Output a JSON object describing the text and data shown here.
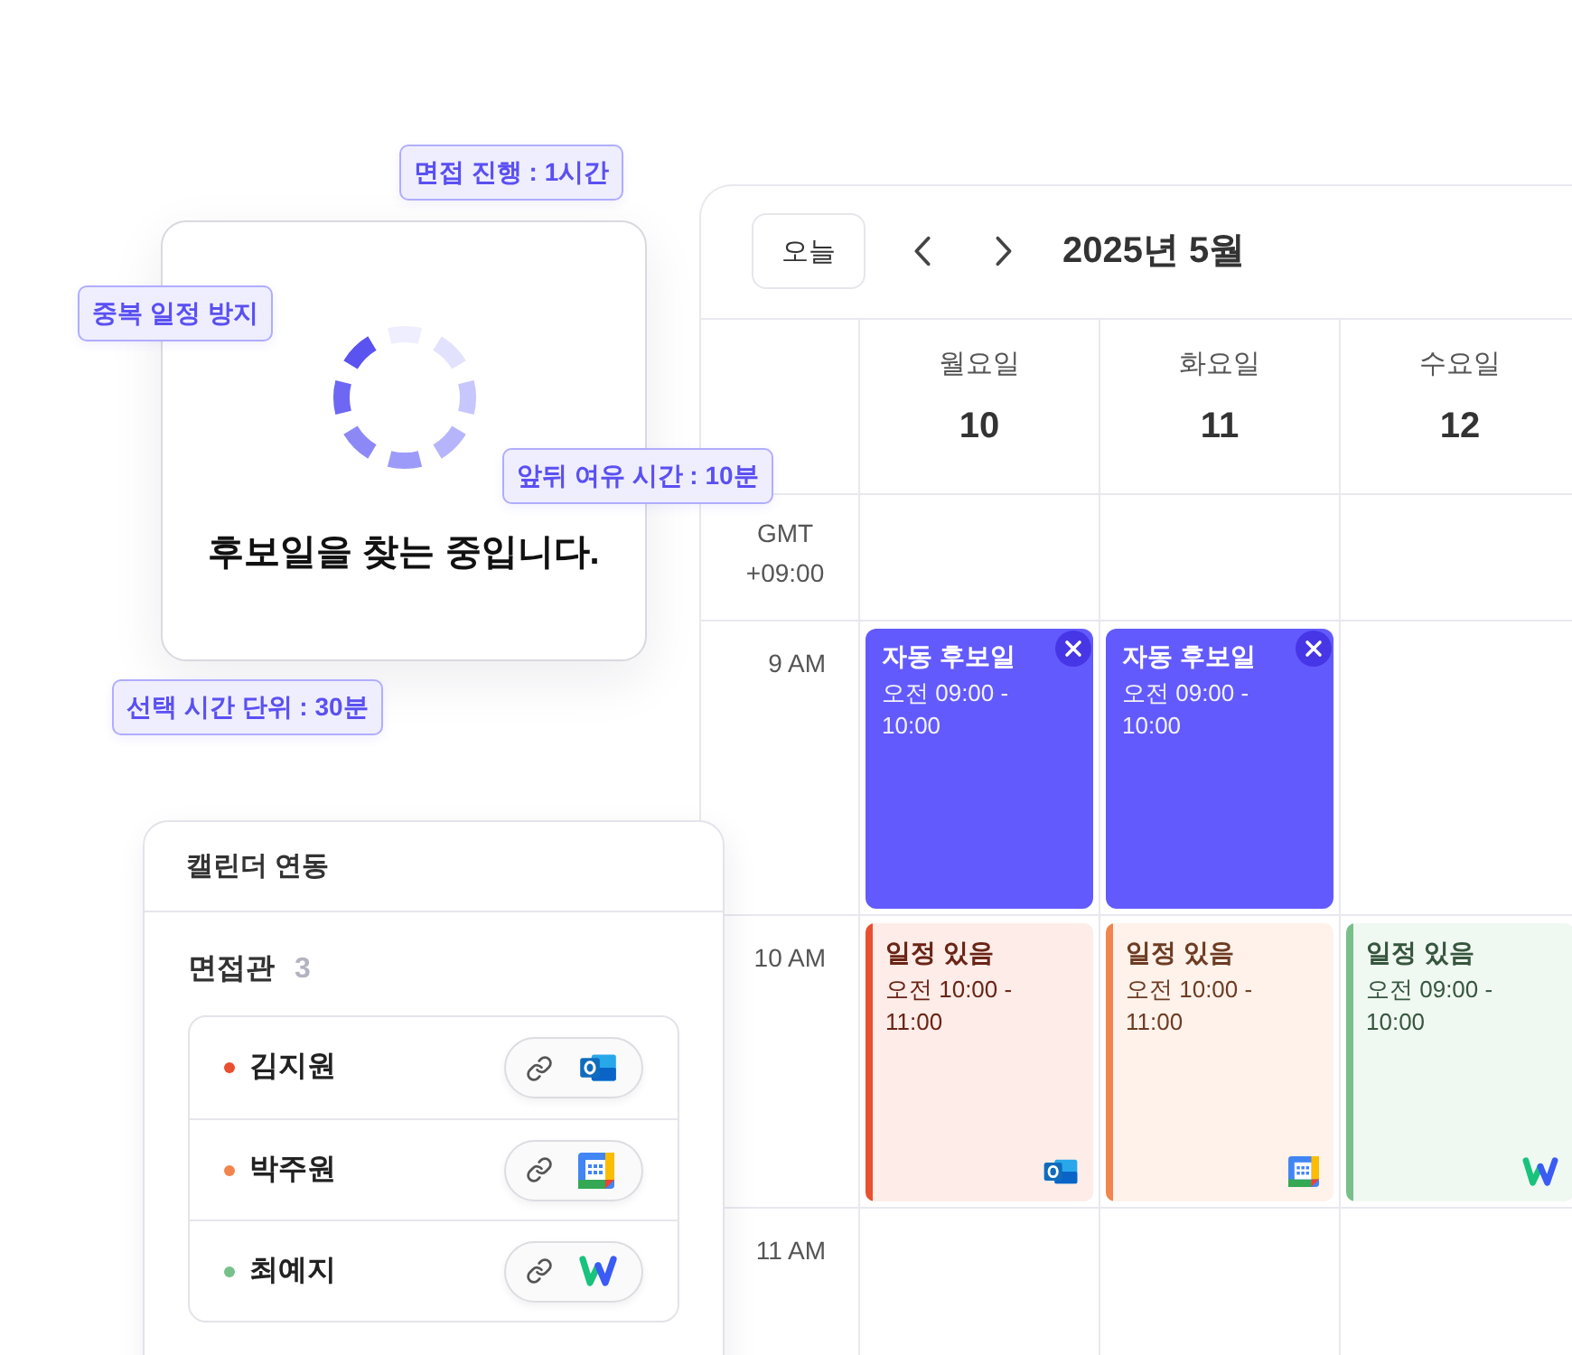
{
  "badges": [
    {
      "text": "면접 진행 : 1시간"
    },
    {
      "text": "중복 일정 방지"
    },
    {
      "text": "앞뒤 여유 시간 : 10분"
    },
    {
      "text": "선택 시간 단위 : 30분"
    }
  ],
  "loading_card": {
    "message": "후보일을 찾는 중입니다."
  },
  "calendar": {
    "today_button": "오늘",
    "title": "2025년 5월",
    "days": [
      {
        "weekday": "월요일",
        "date": "10"
      },
      {
        "weekday": "화요일",
        "date": "11"
      },
      {
        "weekday": "수요일",
        "date": "12"
      }
    ],
    "timezone": "GMT +09:00",
    "rows": [
      {
        "time": "9 AM",
        "cells": [
          {
            "kind": "candidate",
            "title": "자동 후보일",
            "time": "오전 09:00 - 10:00",
            "removable": true
          },
          {
            "kind": "candidate",
            "title": "자동 후보일",
            "time": "오전 09:00 - 10:00",
            "removable": true
          },
          {
            "kind": "empty"
          }
        ]
      },
      {
        "time": "10 AM",
        "cells": [
          {
            "kind": "busy",
            "title": "일정 있음",
            "time": "오전 10:00 - 11:00",
            "color": "#e9502f",
            "source": {
              "kind": "outlook"
            }
          },
          {
            "kind": "busy",
            "title": "일정 있음",
            "time": "오전 10:00 - 11:00",
            "color": "#f2854d",
            "source": {
              "kind": "google"
            }
          },
          {
            "kind": "busy",
            "title": "일정 있음",
            "time": "오전 09:00 - 10:00",
            "color": "#78c08a",
            "source": {
              "kind": "works"
            }
          }
        ]
      },
      {
        "time": "11 AM",
        "cells": [
          {
            "kind": "empty"
          },
          {
            "kind": "empty"
          },
          {
            "kind": "empty"
          }
        ]
      }
    ]
  },
  "calendar_sync": {
    "title": "캘린더 연동",
    "section": "면접관",
    "count": "3",
    "people": [
      {
        "name": "김지원",
        "color": "#e9502f",
        "source": {
          "kind": "outlook"
        }
      },
      {
        "name": "박주원",
        "color": "#f2854d",
        "source": {
          "kind": "google"
        }
      },
      {
        "name": "최예지",
        "color": "#78c08a",
        "source": {
          "kind": "works"
        }
      }
    ]
  }
}
